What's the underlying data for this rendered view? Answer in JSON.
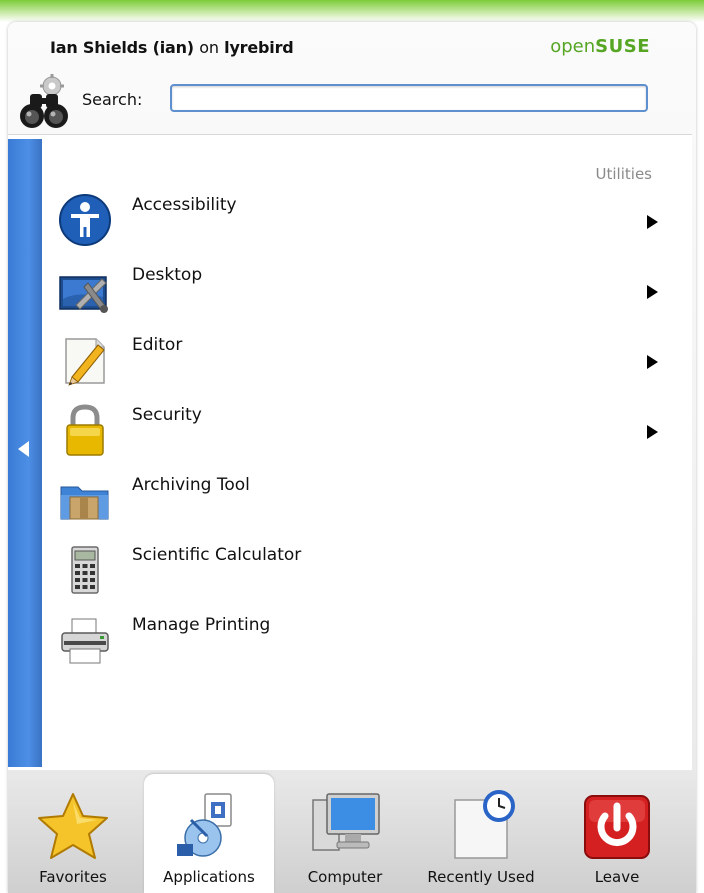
{
  "header": {
    "user_name": "Ian Shields (ian)",
    "on_text": "on",
    "host": "lyrebird",
    "brand_prefix": "open",
    "brand_suffix": "SUSE",
    "brand_color": "#56a624"
  },
  "search": {
    "label": "Search:",
    "value": "",
    "placeholder": ""
  },
  "menu": {
    "category": "Utilities",
    "items": [
      {
        "label": "Accessibility",
        "icon": "accessibility-icon",
        "submenu": true
      },
      {
        "label": "Desktop",
        "icon": "desktop-tools-icon",
        "submenu": true
      },
      {
        "label": "Editor",
        "icon": "editor-pencil-icon",
        "submenu": true
      },
      {
        "label": "Security",
        "icon": "padlock-icon",
        "submenu": true
      },
      {
        "label": "Archiving Tool",
        "icon": "archive-folder-icon",
        "submenu": false
      },
      {
        "label": "Scientific Calculator",
        "icon": "calculator-icon",
        "submenu": false
      },
      {
        "label": "Manage Printing",
        "icon": "printer-icon",
        "submenu": false
      }
    ]
  },
  "tabs": [
    {
      "label": "Favorites",
      "icon": "star-icon",
      "active": false
    },
    {
      "label": "Applications",
      "icon": "applications-icon",
      "active": true
    },
    {
      "label": "Computer",
      "icon": "computer-monitor-icon",
      "active": false
    },
    {
      "label": "Recently Used",
      "icon": "recent-clock-icon",
      "active": false
    },
    {
      "label": "Leave",
      "icon": "power-icon",
      "active": false
    }
  ],
  "colors": {
    "accent_blue": "#3a7bd5",
    "leave_red": "#d42020"
  }
}
